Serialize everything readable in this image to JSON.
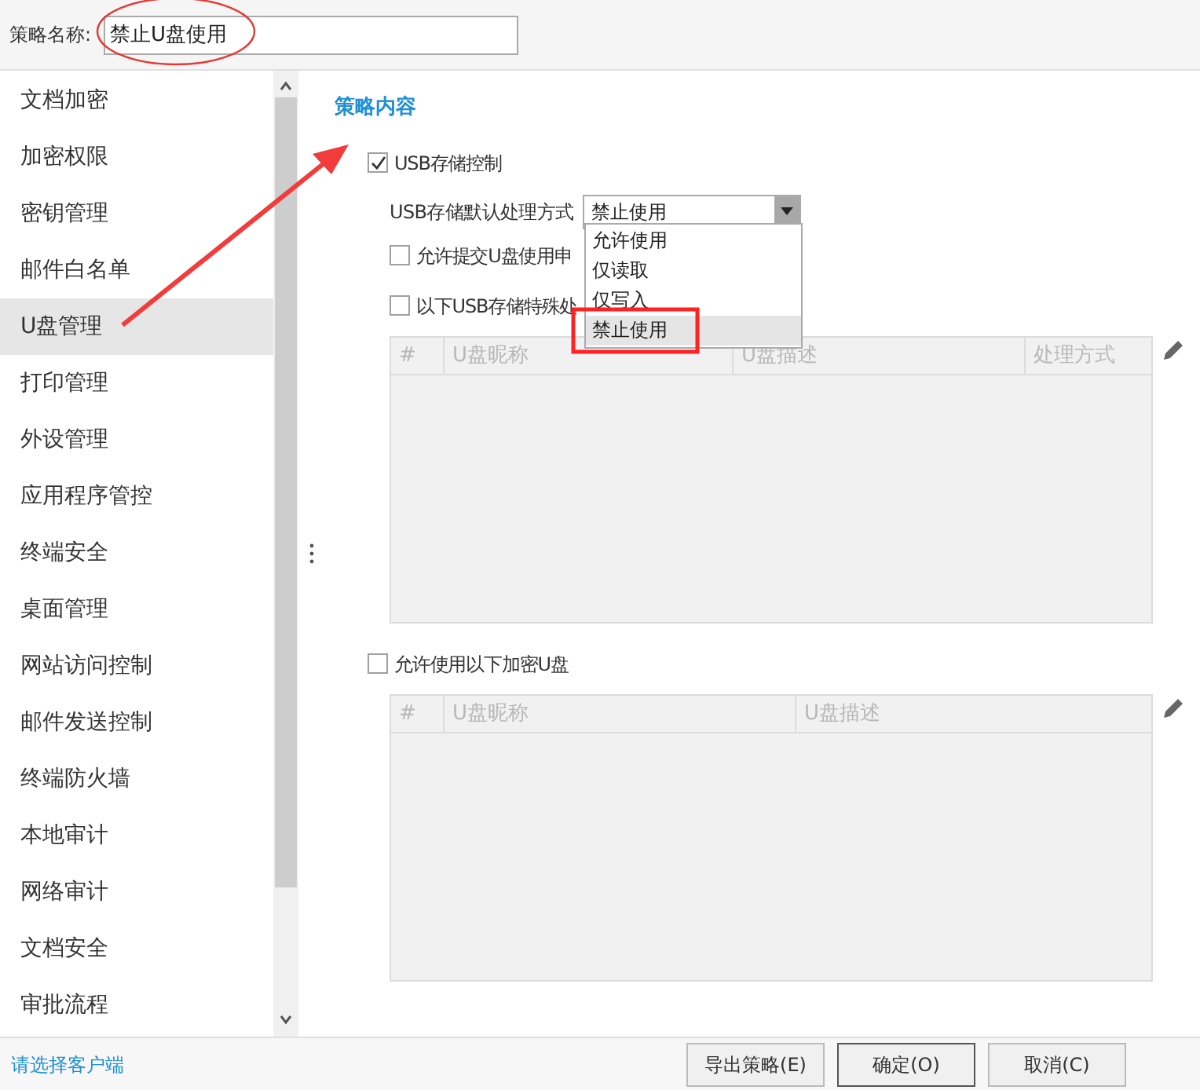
{
  "policy_name": {
    "label": "策略名称:",
    "value": "禁止U盘使用"
  },
  "sidebar": {
    "items": [
      {
        "label": "文档加密",
        "selected": false
      },
      {
        "label": "加密权限",
        "selected": false
      },
      {
        "label": "密钥管理",
        "selected": false
      },
      {
        "label": "邮件白名单",
        "selected": false
      },
      {
        "label": "U盘管理",
        "selected": true
      },
      {
        "label": "打印管理",
        "selected": false
      },
      {
        "label": "外设管理",
        "selected": false
      },
      {
        "label": "应用程序管控",
        "selected": false
      },
      {
        "label": "终端安全",
        "selected": false
      },
      {
        "label": "桌面管理",
        "selected": false
      },
      {
        "label": "网站访问控制",
        "selected": false
      },
      {
        "label": "邮件发送控制",
        "selected": false
      },
      {
        "label": "终端防火墙",
        "selected": false
      },
      {
        "label": "本地审计",
        "selected": false
      },
      {
        "label": "网络审计",
        "selected": false
      },
      {
        "label": "文档安全",
        "selected": false
      },
      {
        "label": "审批流程",
        "selected": false
      }
    ]
  },
  "section_title": "策略内容",
  "usb_control": {
    "label": "USB存储控制",
    "checked": true
  },
  "default_action": {
    "label": "USB存储默认处理方式",
    "value": "禁止使用",
    "options": [
      {
        "label": "允许使用",
        "selected": false
      },
      {
        "label": "仅读取",
        "selected": false
      },
      {
        "label": "仅写入",
        "selected": false
      },
      {
        "label": "禁止使用",
        "selected": true
      }
    ]
  },
  "option_checkboxes": [
    {
      "label": "允许提交U盘使用申",
      "checked": false
    },
    {
      "label": "以下USB存储特殊处",
      "checked": false
    }
  ],
  "special_table": {
    "columns": [
      "#",
      "U盘昵称",
      "U盘描述",
      "处理方式"
    ]
  },
  "encrypted": {
    "label": "允许使用以下加密U盘",
    "checked": false
  },
  "encrypted_table": {
    "columns": [
      "#",
      "U盘昵称",
      "U盘描述"
    ]
  },
  "footer": {
    "link": "请选择客户端",
    "buttons": [
      "导出策略(E)",
      "确定(O)",
      "取消(C)"
    ]
  }
}
